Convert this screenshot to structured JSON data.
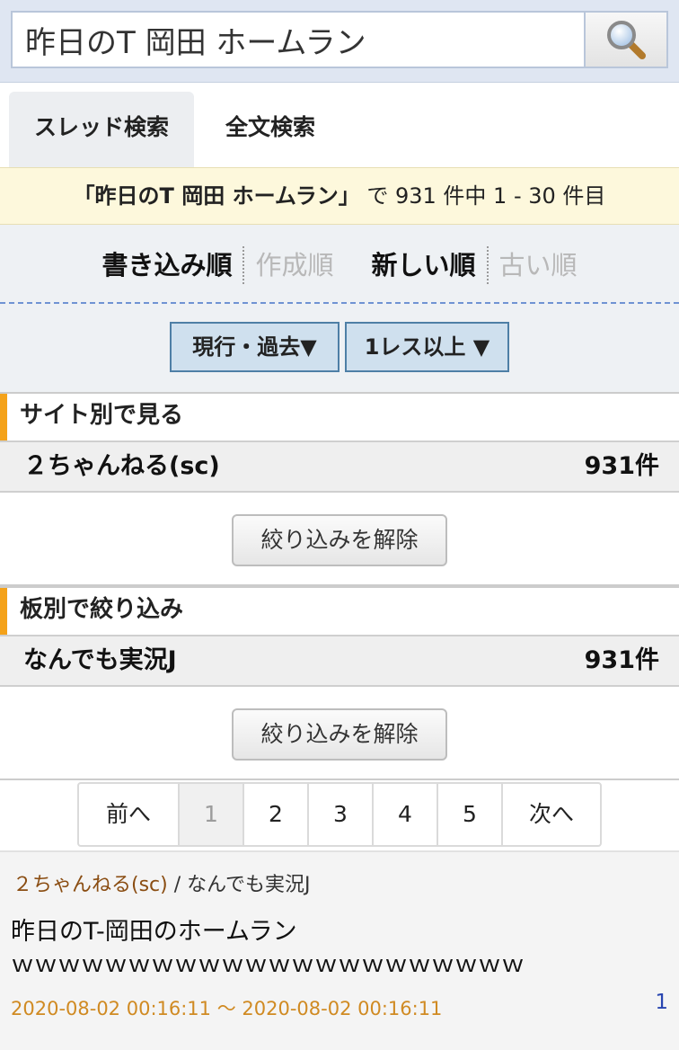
{
  "search": {
    "value": "昨日のT 岡田 ホームラン",
    "button_icon": "magnifier-icon"
  },
  "tabs": [
    {
      "label": "スレッド検索",
      "active": true
    },
    {
      "label": "全文検索",
      "active": false
    }
  ],
  "summary": {
    "query": "「昨日のT 岡田 ホームラン」",
    "text": " で 931 件中 1 - 30 件目"
  },
  "sort": {
    "write_order": "書き込み順",
    "created_order": "作成順",
    "newest": "新しい順",
    "oldest": "古い順"
  },
  "filters": {
    "period": "現行・過去▼",
    "min_res": "1レス以上 ▼"
  },
  "site_panel": {
    "title": "サイト別で見る",
    "name": "２ちゃんねる(sc)",
    "count": "931件",
    "clear_label": "絞り込みを解除"
  },
  "board_panel": {
    "title": "板別で絞り込み",
    "name": "なんでも実況J",
    "count": "931件",
    "clear_label": "絞り込みを解除"
  },
  "pager": {
    "prev": "前へ",
    "pages": [
      "1",
      "2",
      "3",
      "4",
      "5"
    ],
    "current": "1",
    "next": "次へ"
  },
  "results": [
    {
      "site": "２ちゃんねる(sc)",
      "separator": " / ",
      "board": "なんでも実況J",
      "title_line1": "昨日のT-岡田のホームラン",
      "title_line2": "ｗｗｗｗｗｗｗｗｗｗｗｗｗｗｗｗｗｗｗｗｗｗ",
      "dates": "2020-08-02 00:16:11 〜 2020-08-02 00:16:11",
      "res_count": "1"
    }
  ],
  "colors": {
    "accent_bar": "#f4a21a",
    "summary_bg": "#fdf8dc",
    "filter_bg": "#cfe0ee",
    "site_link": "#8a4d12",
    "date_text": "#d08a22",
    "res_count": "#2845b0"
  }
}
